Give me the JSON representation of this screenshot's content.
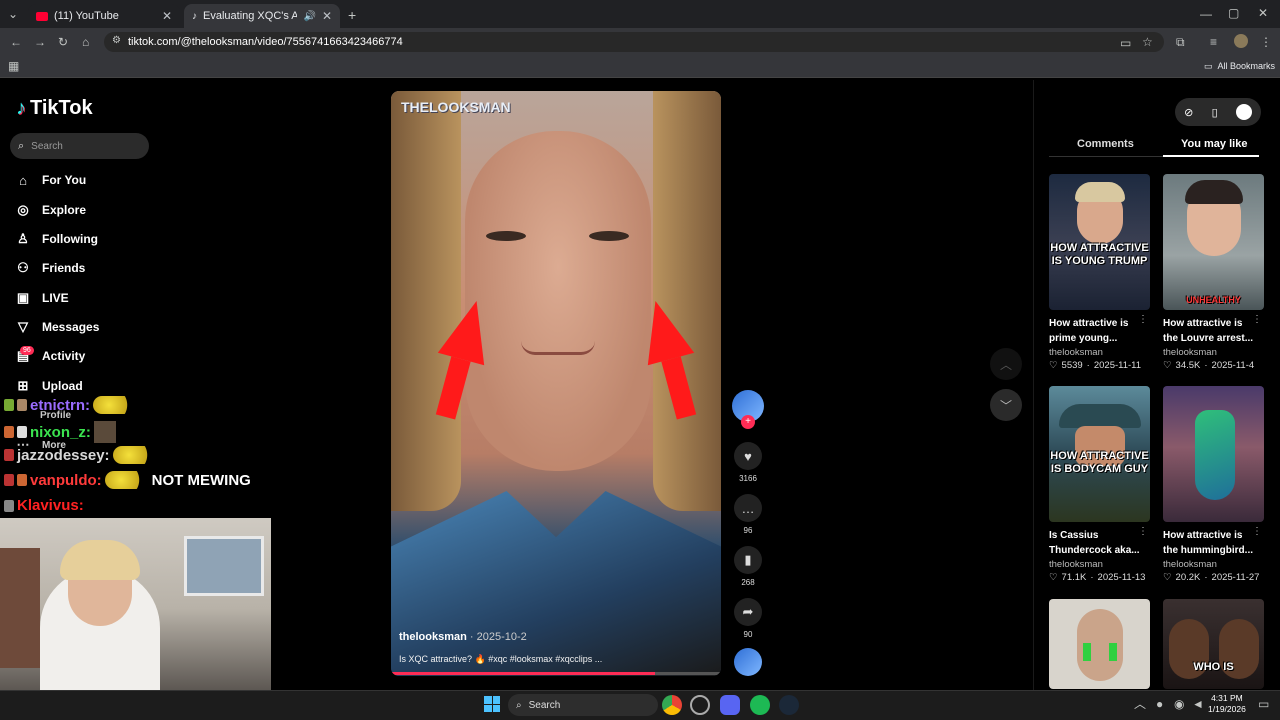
{
  "browser": {
    "tabs": [
      {
        "label": "(11) YouTube",
        "active": false
      },
      {
        "label": "Evaluating XQC's Attractiv",
        "active": true
      }
    ],
    "url": "tiktok.com/@thelooksman/video/7556741663423466774",
    "bookmarks_label": "All Bookmarks"
  },
  "tiktok": {
    "logo": "TikTok",
    "search_placeholder": "Search",
    "nav": [
      {
        "label": "For You",
        "icon": "home-icon"
      },
      {
        "label": "Explore",
        "icon": "compass-icon"
      },
      {
        "label": "Following",
        "icon": "person-icon"
      },
      {
        "label": "Friends",
        "icon": "people-icon"
      },
      {
        "label": "LIVE",
        "icon": "tv-icon"
      },
      {
        "label": "Messages",
        "icon": "send-icon"
      },
      {
        "label": "Activity",
        "icon": "inbox-icon"
      },
      {
        "label": "Upload",
        "icon": "plus-square-icon"
      },
      {
        "label": "Profile",
        "icon": "profile-icon"
      },
      {
        "label": "More",
        "icon": "dots-icon"
      }
    ],
    "activity_badge": "96",
    "chat": [
      {
        "user": "etnictrn:",
        "color": "#9b6cff",
        "msg": ""
      },
      {
        "user": "nixon_z:",
        "color": "#3be34f",
        "msg": ""
      },
      {
        "user": "jazzodessey:",
        "color": "#d8d8d8",
        "msg": ""
      },
      {
        "user": "vanpuldo:",
        "color": "#ff3b3b",
        "msg": "NOT MEWING"
      },
      {
        "user": "Klavivus:",
        "color": "#ff2222",
        "msg": ""
      }
    ],
    "video": {
      "watermark": "THELOOKSMAN",
      "username": "thelooksman",
      "date": "· 2025-10-2",
      "caption": "Is XQC attractive? 🔥 #xqc #looksmax #xqcclips ...",
      "progress": 0.8
    },
    "actions": {
      "likes": "3166",
      "comments": "96",
      "saves": "268",
      "shares": "90"
    },
    "panel_tabs": [
      "Comments",
      "You may like"
    ],
    "recommendations": [
      {
        "title": "How attractive is prime young...",
        "author": "thelooksman",
        "likes": "5539",
        "date": "2025-11-11",
        "overlay": "HOW ATTRACTIVE IS YOUNG TRUMP"
      },
      {
        "title": "How attractive is the Louvre arrest...",
        "author": "thelooksman",
        "likes": "34.5K",
        "date": "2025-11-4",
        "overlay": "UNHEALTHY"
      },
      {
        "title": "Is Cassius Thundercock aka...",
        "author": "thelooksman",
        "likes": "71.1K",
        "date": "2025-11-13",
        "overlay": "HOW ATTRACTIVE IS BODYCAM GUY"
      },
      {
        "title": "How attractive is the hummingbird...",
        "author": "thelooksman",
        "likes": "20.2K",
        "date": "2025-11-27",
        "overlay": ""
      },
      {
        "title": "",
        "author": "",
        "likes": "",
        "date": "",
        "overlay": ""
      },
      {
        "title": "",
        "author": "",
        "likes": "",
        "date": "",
        "overlay": "WHO IS"
      }
    ]
  },
  "taskbar": {
    "search": "Search",
    "time": "4:31 PM",
    "date": "1/19/2026"
  }
}
